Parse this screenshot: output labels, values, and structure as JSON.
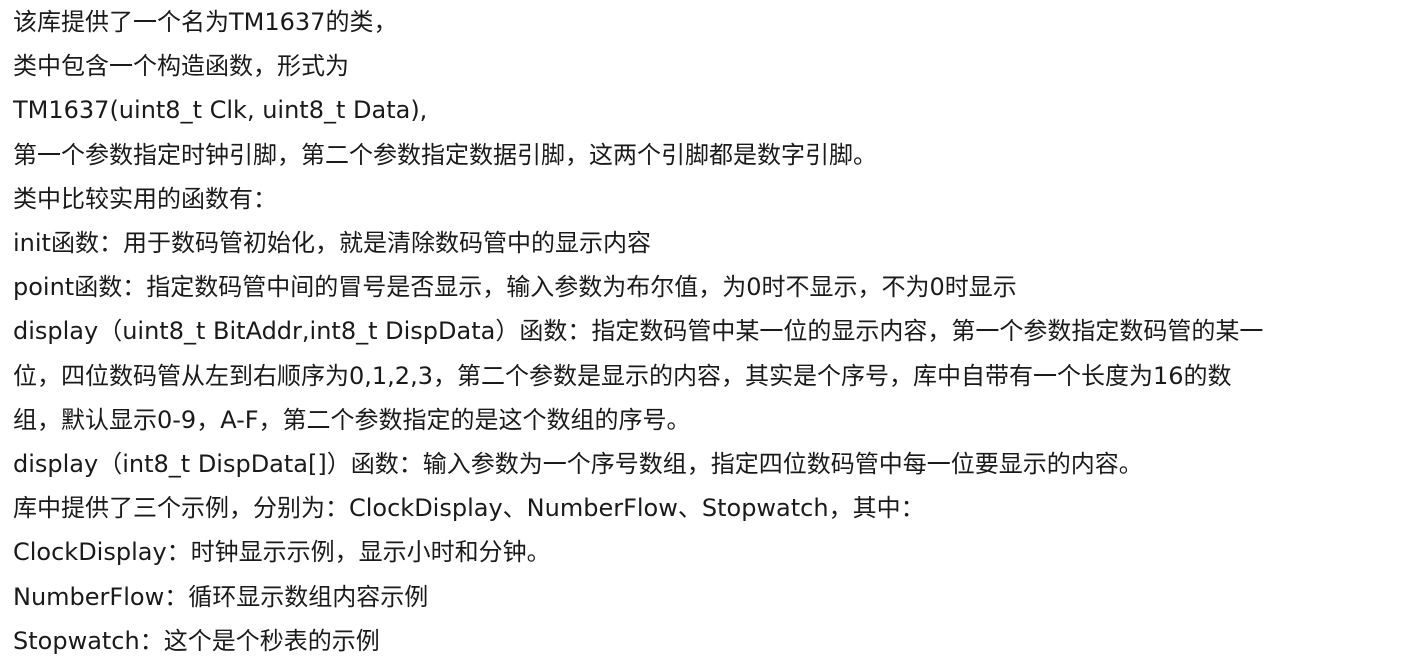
{
  "document": {
    "lines": [
      "该库提供了一个名为TM1637的类，",
      "类中包含一个构造函数，形式为",
      "TM1637(uint8_t Clk, uint8_t Data),",
      "第一个参数指定时钟引脚，第二个参数指定数据引脚，这两个引脚都是数字引脚。",
      "类中比较实用的函数有：",
      "init函数：用于数码管初始化，就是清除数码管中的显示内容",
      "point函数：指定数码管中间的冒号是否显示，输入参数为布尔值，为0时不显示，不为0时显示",
      "display（uint8_t BitAddr,int8_t DispData）函数：指定数码管中某一位的显示内容，第一个参数指定数码管的某一",
      "位，四位数码管从左到右顺序为0,1,2,3，第二个参数是显示的内容，其实是个序号，库中自带有一个长度为16的数",
      "组，默认显示0-9，A-F，第二个参数指定的是这个数组的序号。",
      "display（int8_t DispData[]）函数：输入参数为一个序号数组，指定四位数码管中每一位要显示的内容。",
      "库中提供了三个示例，分别为：ClockDisplay、NumberFlow、Stopwatch，其中：",
      "ClockDisplay：时钟显示示例，显示小时和分钟。",
      "NumberFlow：循环显示数组内容示例",
      "Stopwatch：这个是个秒表的示例"
    ]
  }
}
